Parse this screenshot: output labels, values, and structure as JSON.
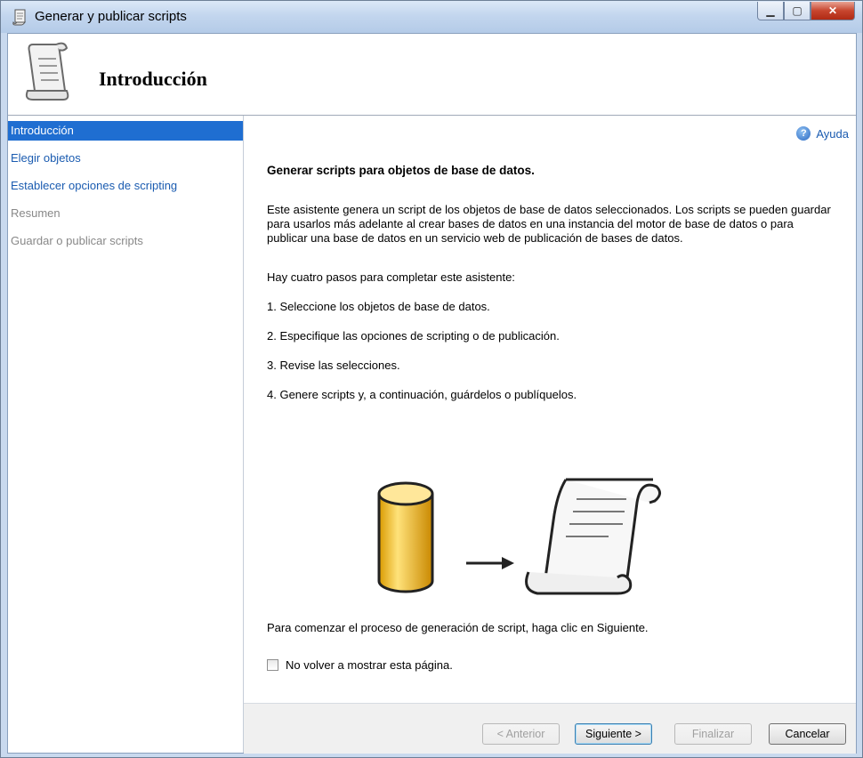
{
  "window": {
    "title": "Generar y publicar scripts"
  },
  "header": {
    "title": "Introducción"
  },
  "sidebar": {
    "items": [
      {
        "label": "Introducción",
        "state": "active"
      },
      {
        "label": "Elegir objetos",
        "state": "link"
      },
      {
        "label": "Establecer opciones de scripting",
        "state": "link"
      },
      {
        "label": "Resumen",
        "state": "disabled"
      },
      {
        "label": "Guardar o publicar scripts",
        "state": "disabled"
      }
    ]
  },
  "main": {
    "help_label": "Ayuda",
    "heading": "Generar scripts para objetos de base de datos.",
    "description": "Este asistente genera un script de los objetos de base de datos seleccionados. Los scripts se pueden guardar para usarlos más adelante al crear bases de datos en una instancia del motor de base de datos o para publicar una base de datos en un servicio web de publicación de bases de datos.",
    "steps_intro": "Hay cuatro pasos para completar este asistente:",
    "steps": [
      "1. Seleccione los objetos de base de datos.",
      " 2. Especifique las opciones de scripting o de publicación.",
      "3. Revise las selecciones.",
      "4. Genere scripts y, a continuación, guárdelos o publíquelos."
    ],
    "start_text": "Para comenzar el proceso de generación de script, haga clic en Siguiente.",
    "checkbox_label": "No volver a mostrar esta página.",
    "checkbox_checked": false
  },
  "footer": {
    "back_label": "< Anterior",
    "next_label": "Siguiente >",
    "finish_label": "Finalizar",
    "cancel_label": "Cancelar"
  },
  "colors": {
    "accent": "#1f6ed1",
    "link": "#1a5bb0"
  }
}
